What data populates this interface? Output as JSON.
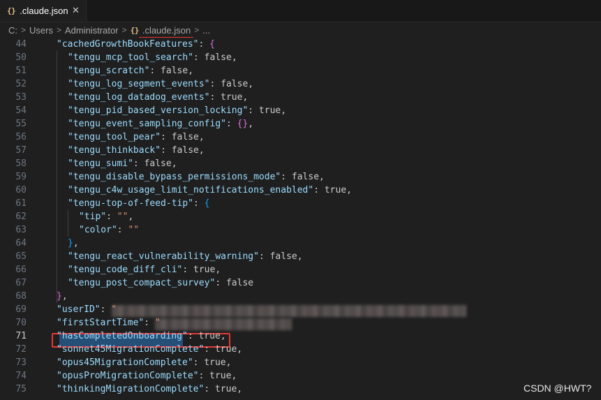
{
  "tab": {
    "icon": "json-braces-icon",
    "label": ".claude.json"
  },
  "breadcrumb": {
    "items": [
      "C:",
      "Users",
      "Administrator"
    ],
    "file_icon": "json-braces-icon",
    "file": ".claude.json",
    "more": "..."
  },
  "editor": {
    "active_line": "71",
    "lines": [
      {
        "num": "44",
        "text": "\"cachedGrowthBookFeatures\": {"
      },
      {
        "num": "50",
        "text": "\"tengu_mcp_tool_search\": false,"
      },
      {
        "num": "51",
        "text": "\"tengu_scratch\": false,"
      },
      {
        "num": "52",
        "text": "\"tengu_log_segment_events\": false,"
      },
      {
        "num": "53",
        "text": "\"tengu_log_datadog_events\": true,"
      },
      {
        "num": "54",
        "text": "\"tengu_pid_based_version_locking\": true,"
      },
      {
        "num": "55",
        "text": "\"tengu_event_sampling_config\": {},"
      },
      {
        "num": "56",
        "text": "\"tengu_tool_pear\": false,"
      },
      {
        "num": "57",
        "text": "\"tengu_thinkback\": false,"
      },
      {
        "num": "58",
        "text": "\"tengu_sumi\": false,"
      },
      {
        "num": "59",
        "text": "\"tengu_disable_bypass_permissions_mode\": false,"
      },
      {
        "num": "60",
        "text": "\"tengu_c4w_usage_limit_notifications_enabled\": true,"
      },
      {
        "num": "61",
        "text": "\"tengu-top-of-feed-tip\": {"
      },
      {
        "num": "62",
        "text": "\"tip\": \"\","
      },
      {
        "num": "63",
        "text": "\"color\": \"\""
      },
      {
        "num": "64",
        "text": "},"
      },
      {
        "num": "65",
        "text": "\"tengu_react_vulnerability_warning\": false,"
      },
      {
        "num": "66",
        "text": "\"tengu_code_diff_cli\": true,"
      },
      {
        "num": "67",
        "text": "\"tengu_post_compact_survey\": false"
      },
      {
        "num": "68",
        "text": "},"
      },
      {
        "num": "69",
        "text": "\"userID\": \""
      },
      {
        "num": "70",
        "text": "\"firstStartTime\": \""
      },
      {
        "num": "71",
        "text": "\"hasCompletedOnboarding\": true,"
      },
      {
        "num": "72",
        "text": "\"sonnet45MigrationComplete\": true,"
      },
      {
        "num": "73",
        "text": "\"opus45MigrationComplete\": true,"
      },
      {
        "num": "74",
        "text": "\"opusProMigrationComplete\": true,"
      },
      {
        "num": "75",
        "text": "\"thinkingMigrationComplete\": true,"
      }
    ]
  },
  "watermark": "CSDN @HWT?",
  "colors": {
    "key": "#9cdcfe",
    "string": "#ce9178",
    "boolean": "#569cd6",
    "highlight_border": "#e53935"
  }
}
